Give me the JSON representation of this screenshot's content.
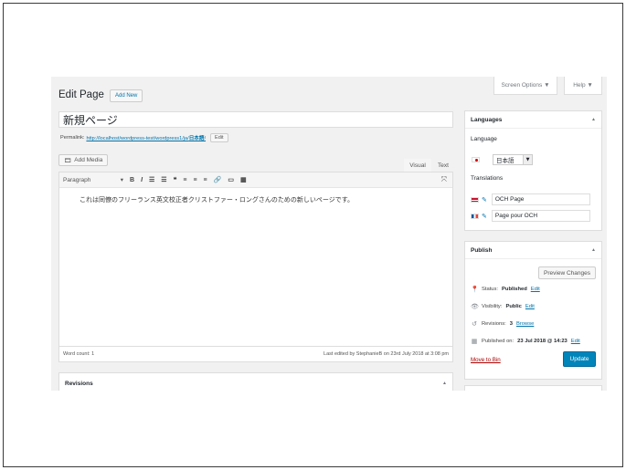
{
  "screen_meta": {
    "screen_options": "Screen Options ▼",
    "help": "Help ▼"
  },
  "header": {
    "title": "Edit Page",
    "add_new": "Add New"
  },
  "post": {
    "title": "新規ページ",
    "permalink_label": "Permalink:",
    "permalink_url": "http://localhost/wordpress-test/wordpress1/ja/",
    "permalink_slug": "日本語",
    "permalink_trail": "/",
    "edit_button": "Edit"
  },
  "editor": {
    "add_media": "Add Media",
    "tab_visual": "Visual",
    "tab_text": "Text",
    "format_select": "Paragraph",
    "content": "これは同僚のフリーランス英文校正者クリストファー・ロングさんのための新しいページです。",
    "word_count": "Word count: 1",
    "last_edited": "Last edited by StephanieB on 23rd July 2018 at 3:08 pm"
  },
  "revisions_box": {
    "title": "Revisions"
  },
  "languages": {
    "title": "Languages",
    "language_label": "Language",
    "selected_language": "日本語",
    "translations_label": "Translations",
    "translations": [
      {
        "flag": "uk",
        "value": "OCH Page"
      },
      {
        "flag": "fr",
        "value": "Page pour OCH"
      }
    ]
  },
  "publish": {
    "title": "Publish",
    "preview_button": "Preview Changes",
    "status_label": "Status:",
    "status_value": "Published",
    "status_edit": "Edit",
    "visibility_label": "Visibility:",
    "visibility_value": "Public",
    "visibility_edit": "Edit",
    "revisions_label": "Revisions:",
    "revisions_value": "3",
    "revisions_browse": "Browse",
    "published_label": "Published on:",
    "published_value": "23 Jul 2018 @ 14:23",
    "published_edit": "Edit",
    "move_to_bin": "Move to Bin",
    "update_button": "Update"
  },
  "colors": {
    "primary_button": "#0085ba",
    "link": "#0073aa",
    "delete": "#a00"
  }
}
